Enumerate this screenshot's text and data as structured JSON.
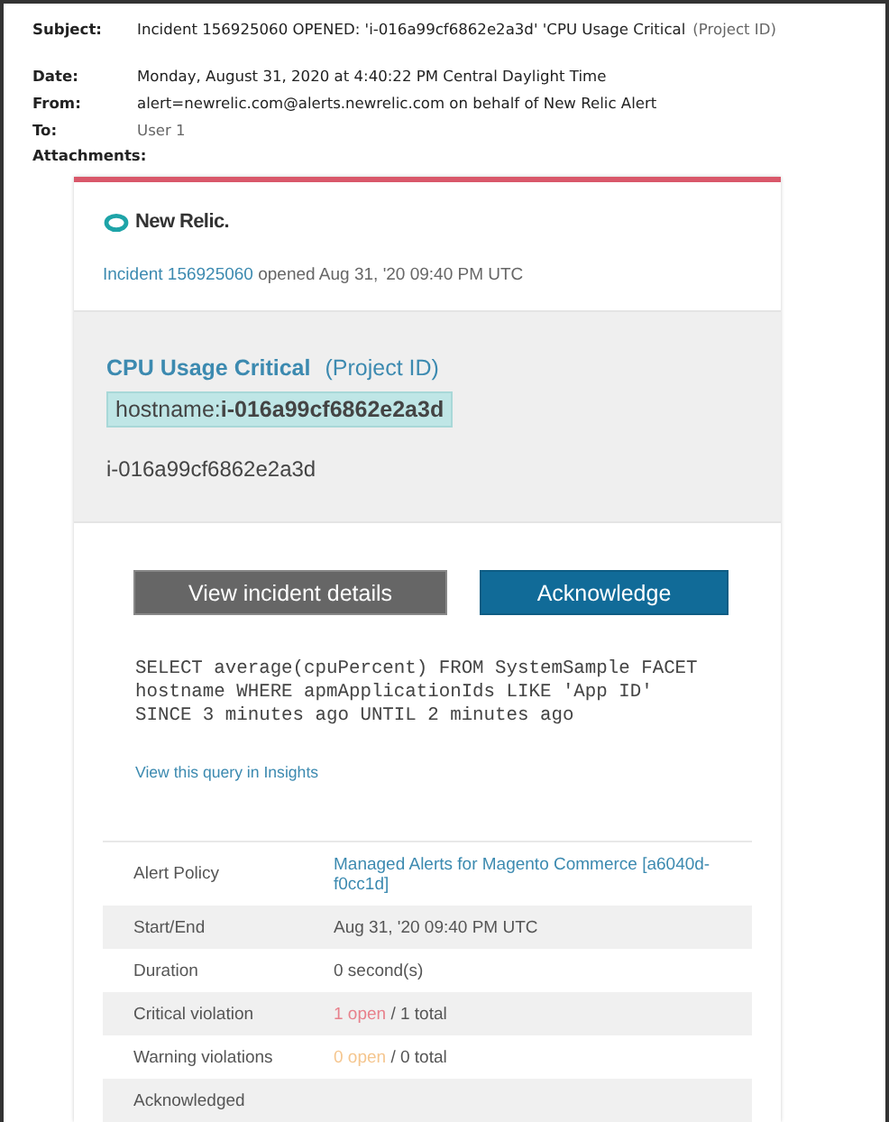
{
  "header": {
    "fields": [
      {
        "label": "Subject:",
        "value": "Incident 156925060 OPENED: 'i-016a99cf6862e2a3d' 'CPU Usage Critical",
        "suffix": "(Project ID)"
      },
      {
        "label": "Date:",
        "value": "Monday, August 31, 2020 at 4:40:22 PM Central Daylight Time"
      },
      {
        "label": "From:",
        "value": "alert=newrelic.com@alerts.newrelic.com on behalf of New Relic Alert"
      },
      {
        "label": "To:",
        "suffix": "User 1"
      },
      {
        "label": "Attachments:"
      }
    ]
  },
  "email": {
    "logo": "New Relic.",
    "incident_link": "Incident 156925060",
    "incident_text": " opened Aug 31, '20 09:40 PM UTC",
    "condition": {
      "title": "CPU Usage Critical",
      "project": "(Project ID)",
      "hostname": "hostname:**i-016a99cf6862e2a3d**",
      "entity": "i-016a99cf6862e2a3d"
    },
    "buttons": [
      {
        "label": "View incident details",
        "kind": "secondary"
      },
      {
        "label": "Acknowledge",
        "kind": "primary"
      }
    ],
    "query": [
      "SELECT average(cpuPercent) FROM SystemSample FACET",
      "hostname WHERE apmApplicationIds LIKE 'App ID'",
      "SINCE 3 minutes ago UNTIL 2 minutes ago"
    ],
    "query_link": "View this query in Insights",
    "details": [
      {
        "label": "Alert Policy",
        "kind": "link",
        "value": "Managed Alerts for Magento Commerce [a6040d-f0cc1d]"
      },
      {
        "label": "Start/End",
        "kind": "text",
        "value": "Aug 31, '20 09:40 PM UTC"
      },
      {
        "label": "Duration",
        "kind": "text",
        "value": "0 second(s)"
      },
      {
        "label": "Critical violation",
        "kind": "count",
        "open": "1 open",
        "total": " / 1 total",
        "color": "#e8818c"
      },
      {
        "label": "Warning violations",
        "kind": "count",
        "open": "0 open",
        "total": " / 0 total",
        "color": "#f5c68f"
      },
      {
        "label": "Acknowledged",
        "kind": "empty"
      }
    ]
  }
}
